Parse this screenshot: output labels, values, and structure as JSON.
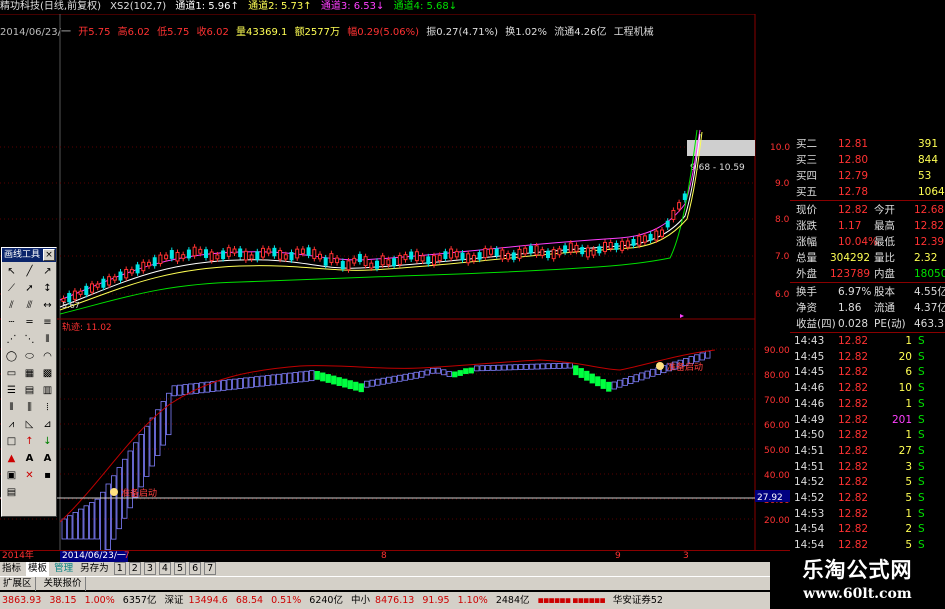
{
  "title_line": {
    "name": "精功科技(日线,前复权)",
    "xs2": "XS2(102,7)",
    "ch1": "通道1: 5.96↑",
    "ch2": "通道2: 5.73↑",
    "ch3": "通道3: 6.53↓",
    "ch4": "通道4: 5.68↓"
  },
  "price_line": {
    "date": "2014/06/23/一",
    "open": "开5.75",
    "high": "高6.02",
    "low": "低5.75",
    "close": "收6.02",
    "volume": "量43369.1",
    "amount": "额2577万",
    "change": "幅0.29(5.06%)",
    "amplitude": "振0.27(4.71%)",
    "turnover": "换1.02%",
    "float_cap": "流通4.26亿",
    "sector": "工程机械"
  },
  "main_chart": {
    "price_box_label": "9.68 - 10.59",
    "low_label": "5.67",
    "y_ticks": [
      "10.00",
      "9.00",
      "8.00",
      "7.00",
      "6.00"
    ]
  },
  "indicator": {
    "title": "轨迹: 11.02",
    "signal_label": "准备启动",
    "current_value": "27.92",
    "y_ticks": [
      "90.00",
      "80.00",
      "70.00",
      "60.00",
      "50.00",
      "40.00",
      "30.00",
      "20.00"
    ]
  },
  "date_bar": {
    "year": "2014年",
    "current_date": "2014/06/23/一",
    "months": [
      "7",
      "8",
      "9",
      "3"
    ]
  },
  "quote_panel": {
    "bids": [
      {
        "label": "买二",
        "price": "12.81",
        "vol": "391"
      },
      {
        "label": "买三",
        "price": "12.80",
        "vol": "844"
      },
      {
        "label": "买四",
        "price": "12.79",
        "vol": "53"
      },
      {
        "label": "买五",
        "price": "12.78",
        "vol": "1064"
      }
    ],
    "stats": [
      {
        "l1": "现价",
        "v1": "12.82",
        "l2": "今开",
        "v2": "12.68"
      },
      {
        "l1": "涨跌",
        "v1": "1.17",
        "l2": "最高",
        "v2": "12.82"
      },
      {
        "l1": "涨幅",
        "v1": "10.04%",
        "l2": "最低",
        "v2": "12.39"
      },
      {
        "l1": "总量",
        "v1": "304292",
        "l2": "量比",
        "v2": "2.32"
      },
      {
        "l1": "外盘",
        "v1": "123789",
        "l2": "内盘",
        "v2": "180503"
      }
    ],
    "fundamentals": [
      {
        "l1": "换手",
        "v1": "6.97%",
        "l2": "股本",
        "v2": "4.55亿"
      },
      {
        "l1": "净资",
        "v1": "1.86",
        "l2": "流通",
        "v2": "4.37亿"
      },
      {
        "l1": "收益(四)",
        "v1": "0.028",
        "l2": "PE(动)",
        "v2": "463.3"
      }
    ],
    "ticks": [
      {
        "time": "14:43",
        "price": "12.82",
        "vol": "1",
        "bs": "S"
      },
      {
        "time": "14:45",
        "price": "12.82",
        "vol": "20",
        "bs": "S"
      },
      {
        "time": "14:45",
        "price": "12.82",
        "vol": "6",
        "bs": "S"
      },
      {
        "time": "14:46",
        "price": "12.82",
        "vol": "10",
        "bs": "S"
      },
      {
        "time": "14:46",
        "price": "12.82",
        "vol": "1",
        "bs": "S"
      },
      {
        "time": "14:49",
        "price": "12.82",
        "vol": "201",
        "bs": "S"
      },
      {
        "time": "14:50",
        "price": "12.82",
        "vol": "1",
        "bs": "S"
      },
      {
        "time": "14:51",
        "price": "12.82",
        "vol": "27",
        "bs": "S"
      },
      {
        "time": "14:51",
        "price": "12.82",
        "vol": "3",
        "bs": "S"
      },
      {
        "time": "14:52",
        "price": "12.82",
        "vol": "5",
        "bs": "S"
      },
      {
        "time": "14:52",
        "price": "12.82",
        "vol": "5",
        "bs": "S"
      },
      {
        "time": "14:53",
        "price": "12.82",
        "vol": "1",
        "bs": "S"
      },
      {
        "time": "14:54",
        "price": "12.82",
        "vol": "2",
        "bs": "S"
      },
      {
        "time": "14:54",
        "price": "12.82",
        "vol": "5",
        "bs": "S"
      },
      {
        "time": "14:55",
        "price": "12.82",
        "vol": "10",
        "bs": "S"
      },
      {
        "time": "14:56",
        "price": "12.82",
        "vol": "40",
        "bs": "S"
      },
      {
        "time": "14:56",
        "price": "12.82",
        "vol": "1",
        "bs": "S"
      }
    ]
  },
  "toolbox": {
    "title": "画线工具",
    "close": "×"
  },
  "tabs_bar": {
    "items": [
      "指标",
      "模板",
      "管理",
      "另存为",
      "1",
      "2",
      "3",
      "4",
      "5",
      "6",
      "7"
    ]
  },
  "ext_bar": {
    "items": [
      "扩展区",
      "关联报价"
    ]
  },
  "status_bar": {
    "sh_index": "3863.93",
    "sh_change": "38.15",
    "sh_pct": "1.00%",
    "sh_amount": "6357亿",
    "sz_label": "深证",
    "sz_index": "13494.6",
    "sz_change": "68.54",
    "sz_pct": "0.51%",
    "sz_amount": "6240亿",
    "zx_label": "中小",
    "zx_index": "8476.13",
    "zx_change": "91.95",
    "zx_pct": "1.10%",
    "zx_amount": "2484亿",
    "broker": "华安证券52"
  },
  "watermark": {
    "title": "乐淘公式网",
    "url": "www.60lt.com"
  },
  "colors": {
    "up": "#ff3232",
    "down": "#00e5e5",
    "flat": "#ffffff",
    "yellow": "#ffff54",
    "green": "#00e000",
    "magenta": "#ff40ff",
    "grid_red": "#8a0000"
  }
}
